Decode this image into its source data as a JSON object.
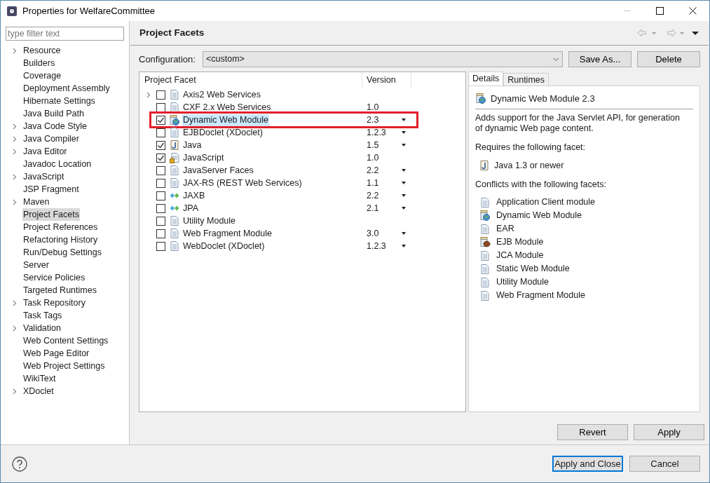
{
  "window": {
    "title": "Properties for WelfareCommittee"
  },
  "filter": {
    "placeholder": "type filter text"
  },
  "sidebar": {
    "items": [
      {
        "label": "Resource",
        "expandable": true,
        "selected": false
      },
      {
        "label": "Builders",
        "expandable": false,
        "selected": false
      },
      {
        "label": "Coverage",
        "expandable": false,
        "selected": false
      },
      {
        "label": "Deployment Assembly",
        "expandable": false,
        "selected": false
      },
      {
        "label": "Hibernate Settings",
        "expandable": false,
        "selected": false
      },
      {
        "label": "Java Build Path",
        "expandable": false,
        "selected": false
      },
      {
        "label": "Java Code Style",
        "expandable": true,
        "selected": false
      },
      {
        "label": "Java Compiler",
        "expandable": true,
        "selected": false
      },
      {
        "label": "Java Editor",
        "expandable": true,
        "selected": false
      },
      {
        "label": "Javadoc Location",
        "expandable": false,
        "selected": false
      },
      {
        "label": "JavaScript",
        "expandable": true,
        "selected": false
      },
      {
        "label": "JSP Fragment",
        "expandable": false,
        "selected": false
      },
      {
        "label": "Maven",
        "expandable": true,
        "selected": false
      },
      {
        "label": "Project Facets",
        "expandable": false,
        "selected": true
      },
      {
        "label": "Project References",
        "expandable": false,
        "selected": false
      },
      {
        "label": "Refactoring History",
        "expandable": false,
        "selected": false
      },
      {
        "label": "Run/Debug Settings",
        "expandable": false,
        "selected": false
      },
      {
        "label": "Server",
        "expandable": false,
        "selected": false
      },
      {
        "label": "Service Policies",
        "expandable": false,
        "selected": false
      },
      {
        "label": "Targeted Runtimes",
        "expandable": false,
        "selected": false
      },
      {
        "label": "Task Repository",
        "expandable": true,
        "selected": false
      },
      {
        "label": "Task Tags",
        "expandable": false,
        "selected": false
      },
      {
        "label": "Validation",
        "expandable": true,
        "selected": false
      },
      {
        "label": "Web Content Settings",
        "expandable": false,
        "selected": false
      },
      {
        "label": "Web Page Editor",
        "expandable": false,
        "selected": false
      },
      {
        "label": "Web Project Settings",
        "expandable": false,
        "selected": false
      },
      {
        "label": "WikiText",
        "expandable": false,
        "selected": false
      },
      {
        "label": "XDoclet",
        "expandable": true,
        "selected": false
      }
    ]
  },
  "page": {
    "title": "Project Facets",
    "configuration_label": "Configuration:",
    "configuration_value": "<custom>",
    "buttons": [
      "Save As...",
      "Delete"
    ]
  },
  "facets": {
    "columns": [
      "Project Facet",
      "Version"
    ],
    "rows": [
      {
        "name": "Axis2 Web Services",
        "version": "",
        "kind": "doc",
        "expandable": true,
        "checked": false,
        "dropdown": false,
        "selected": false,
        "highlighted": false
      },
      {
        "name": "CXF 2.x Web Services",
        "version": "1.0",
        "kind": "doc",
        "expandable": false,
        "checked": false,
        "dropdown": false,
        "selected": false,
        "highlighted": false
      },
      {
        "name": "Dynamic Web Module",
        "version": "2.3",
        "kind": "web",
        "expandable": false,
        "checked": true,
        "dropdown": true,
        "selected": true,
        "highlighted": true
      },
      {
        "name": "EJBDoclet (XDoclet)",
        "version": "1.2.3",
        "kind": "doc",
        "expandable": false,
        "checked": false,
        "dropdown": true,
        "selected": false,
        "highlighted": false
      },
      {
        "name": "Java",
        "version": "1.5",
        "kind": "java",
        "expandable": false,
        "checked": true,
        "dropdown": true,
        "selected": false,
        "highlighted": false
      },
      {
        "name": "JavaScript",
        "version": "1.0",
        "kind": "locked",
        "expandable": false,
        "checked": true,
        "dropdown": false,
        "selected": false,
        "highlighted": false
      },
      {
        "name": "JavaServer Faces",
        "version": "2.2",
        "kind": "doc",
        "expandable": false,
        "checked": false,
        "dropdown": true,
        "selected": false,
        "highlighted": false
      },
      {
        "name": "JAX-RS (REST Web Services)",
        "version": "1.1",
        "kind": "doc",
        "expandable": false,
        "checked": false,
        "dropdown": true,
        "selected": false,
        "highlighted": false
      },
      {
        "name": "JAXB",
        "version": "2.2",
        "kind": "arrows",
        "expandable": false,
        "checked": false,
        "dropdown": true,
        "selected": false,
        "highlighted": false
      },
      {
        "name": "JPA",
        "version": "2.1",
        "kind": "arrows",
        "expandable": false,
        "checked": false,
        "dropdown": true,
        "selected": false,
        "highlighted": false
      },
      {
        "name": "Utility Module",
        "version": "",
        "kind": "doc",
        "expandable": false,
        "checked": false,
        "dropdown": false,
        "selected": false,
        "highlighted": false
      },
      {
        "name": "Web Fragment Module",
        "version": "3.0",
        "kind": "doc",
        "expandable": false,
        "checked": false,
        "dropdown": true,
        "selected": false,
        "highlighted": false
      },
      {
        "name": "WebDoclet (XDoclet)",
        "version": "1.2.3",
        "kind": "doc",
        "expandable": false,
        "checked": false,
        "dropdown": true,
        "selected": false,
        "highlighted": false
      }
    ]
  },
  "details": {
    "tabs": [
      {
        "label": "Details",
        "selected": true
      },
      {
        "label": "Runtimes",
        "selected": false
      }
    ],
    "title": "Dynamic Web Module 2.3",
    "description": "Adds support for the Java Servlet API, for generation of dynamic Web page content.",
    "requires_heading": "Requires the following facet:",
    "requires": [
      {
        "label": "Java 1.3 or newer",
        "kind": "java"
      }
    ],
    "conflicts_heading": "Conflicts with the following facets:",
    "conflicts": [
      {
        "label": "Application Client module",
        "kind": "doc"
      },
      {
        "label": "Dynamic Web Module",
        "kind": "web"
      },
      {
        "label": "EAR",
        "kind": "doc"
      },
      {
        "label": "EJB Module",
        "kind": "ejb"
      },
      {
        "label": "JCA Module",
        "kind": "doc"
      },
      {
        "label": "Static Web Module",
        "kind": "doc"
      },
      {
        "label": "Utility Module",
        "kind": "doc"
      },
      {
        "label": "Web Fragment Module",
        "kind": "doc"
      }
    ]
  },
  "page_buttons": [
    "Revert",
    "Apply"
  ],
  "footer_buttons": [
    {
      "label": "Apply and Close",
      "default": true
    },
    {
      "label": "Cancel",
      "default": false
    }
  ]
}
